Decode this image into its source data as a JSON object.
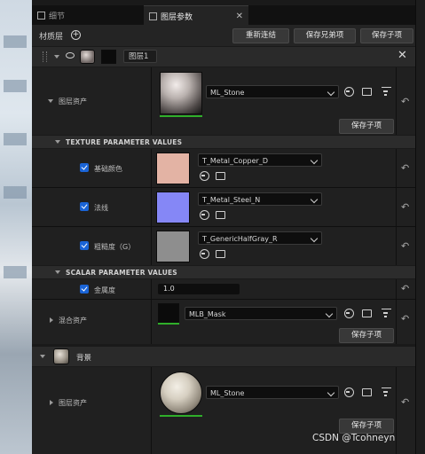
{
  "tabs": [
    {
      "label": "细节"
    },
    {
      "label": "图层参数"
    }
  ],
  "header": {
    "title": "材质层",
    "relink_label": "重新连结",
    "save_sibling_label": "保存兄弟项",
    "save_child_label": "保存子项"
  },
  "layer1": {
    "name": "图层1",
    "asset_label": "图层资产",
    "asset_value": "ML_Stone",
    "save_child_label": "保存子项",
    "texture_section": "TEXTURE PARAMETER VALUES",
    "params": [
      {
        "label": "基础颜色",
        "value": "T_Metal_Copper_D",
        "color": "#e3b3a4"
      },
      {
        "label": "法线",
        "value": "T_Metal_Steel_N",
        "color": "#8587f6"
      },
      {
        "label": "粗糙度（G）",
        "value": "T_GenericHalfGray_R",
        "color": "#8e8e8e"
      }
    ],
    "scalar_section": "SCALAR PARAMETER VALUES",
    "scalar": {
      "label": "金属度",
      "value": "1.0"
    },
    "blend_label": "混合资产",
    "blend_value": "MLB_Mask",
    "blend_save_label": "保存子项"
  },
  "background_layer": {
    "name": "背景",
    "asset_label": "图层资产",
    "asset_value": "ML_Stone",
    "save_child_label": "保存子项"
  },
  "watermark": "CSDN @Tcohneyn",
  "colors": {
    "accent_check": "#1a64d6",
    "green_bar": "#2fae2a"
  },
  "icons": [
    "use-selected-icon",
    "browse-icon",
    "folder-icon",
    "options-icon",
    "reset-arrow-icon",
    "eye-icon",
    "close-icon"
  ]
}
